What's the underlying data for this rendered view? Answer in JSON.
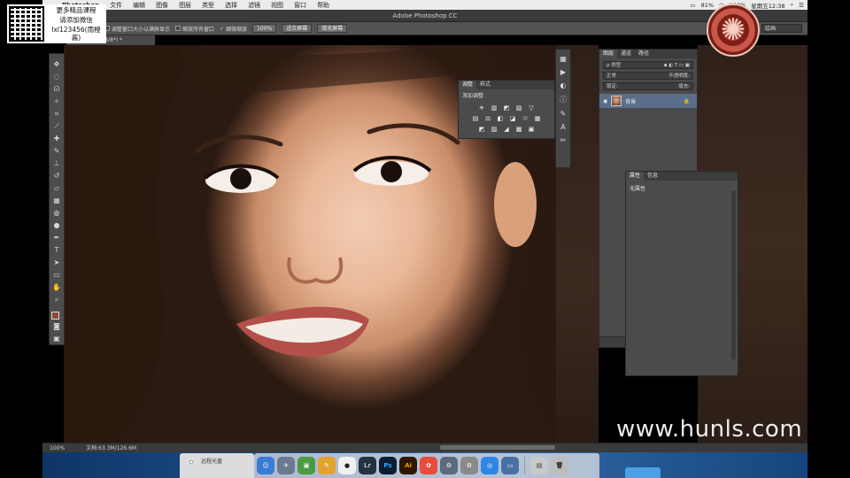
{
  "menubar": {
    "app_name": "Photoshop",
    "items": [
      "文件",
      "编辑",
      "图像",
      "图层",
      "类型",
      "选择",
      "滤镜",
      "视图",
      "窗口",
      "帮助"
    ],
    "battery": "81%",
    "battery2": "100%",
    "clock": "星期五12:38"
  },
  "window": {
    "title": "Adobe Photoshop CC"
  },
  "options": {
    "resize_label": "调整窗口大小以满屏显示",
    "zoom_all_label": "缩放所有窗口",
    "scrubby_label": "细微缩放",
    "btn_100": "100%",
    "btn_fit": "适合屏幕",
    "btn_fill": "填充屏幕",
    "workspace": "绘画"
  },
  "document": {
    "tab": "%(RGB/8*) *"
  },
  "adjustments": {
    "tabs": [
      "调整",
      "样式"
    ],
    "title": "添加调整",
    "row1": [
      "☀",
      "▥",
      "◩",
      "▨",
      "▽"
    ],
    "row2": [
      "▤",
      "⚖",
      "◧",
      "◪",
      "♲",
      "▦"
    ],
    "row3": [
      "◩",
      "▧",
      "◢",
      "▩",
      "▣"
    ]
  },
  "layers": {
    "tabs": [
      "图层",
      "通道",
      "路径"
    ],
    "filter_label": "ρ 类型",
    "blend_mode": "正常",
    "opacity_label": "不透明度:",
    "lock_label": "锁定:",
    "fill_label": "填充:",
    "layer_name": "背景",
    "lock_icon": "🔒"
  },
  "properties": {
    "tabs": [
      "属性",
      "信息"
    ],
    "empty": "无属性"
  },
  "status": {
    "zoom": "100%",
    "doc_size": "文档:63.3M/126.6M"
  },
  "dock": {
    "finder_label": "远程光盘",
    "apps": [
      "Lr",
      "Ps",
      "Ai"
    ]
  },
  "promo": {
    "line1": "更多精品课程",
    "line2": "请添加微信",
    "line3": "lxl123456(雨橙酱)"
  },
  "watermark": "www.hunls.com"
}
